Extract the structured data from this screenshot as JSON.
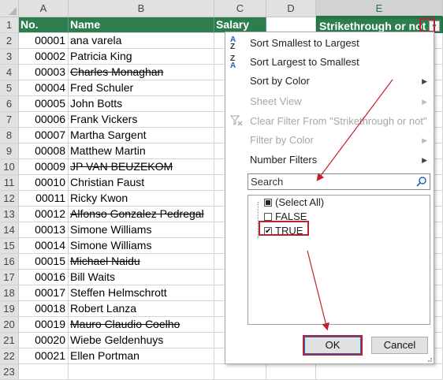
{
  "columns": [
    "A",
    "B",
    "C",
    "D",
    "E"
  ],
  "header_row": {
    "row_number": "1",
    "no": "No.",
    "name": "Name",
    "salary": "Salary",
    "flag": "Strikethrough or not"
  },
  "rows": [
    {
      "row": "2",
      "no": "00001",
      "name": "ana varela",
      "strike": false
    },
    {
      "row": "3",
      "no": "00002",
      "name": "Patricia King",
      "strike": false
    },
    {
      "row": "4",
      "no": "00003",
      "name": "Charles Monaghan",
      "strike": true
    },
    {
      "row": "5",
      "no": "00004",
      "name": "Fred Schuler",
      "strike": false
    },
    {
      "row": "6",
      "no": "00005",
      "name": "John Botts",
      "strike": false
    },
    {
      "row": "7",
      "no": "00006",
      "name": "Frank Vickers",
      "strike": false
    },
    {
      "row": "8",
      "no": "00007",
      "name": "Martha Sargent",
      "strike": false
    },
    {
      "row": "9",
      "no": "00008",
      "name": "Matthew Martin",
      "strike": false
    },
    {
      "row": "10",
      "no": "00009",
      "name": "JP VAN BEUZEKOM",
      "strike": true
    },
    {
      "row": "11",
      "no": "00010",
      "name": "Christian Faust",
      "strike": false
    },
    {
      "row": "12",
      "no": "00011",
      "name": "Ricky Kwon",
      "strike": false
    },
    {
      "row": "13",
      "no": "00012",
      "name": "Alfonso Gonzalez Pedregal",
      "strike": true
    },
    {
      "row": "14",
      "no": "00013",
      "name": "Simone Williams",
      "strike": false
    },
    {
      "row": "15",
      "no": "00014",
      "name": "Simone Williams",
      "strike": false
    },
    {
      "row": "16",
      "no": "00015",
      "name": "Michael Naidu",
      "strike": true
    },
    {
      "row": "17",
      "no": "00016",
      "name": "Bill Waits",
      "strike": false
    },
    {
      "row": "18",
      "no": "00017",
      "name": "Steffen Helmschrott",
      "strike": false
    },
    {
      "row": "19",
      "no": "00018",
      "name": "Robert Lanza",
      "strike": false
    },
    {
      "row": "20",
      "no": "00019",
      "name": "Mauro Claudio Coelho",
      "strike": true
    },
    {
      "row": "21",
      "no": "00020",
      "name": "Wiebe Geldenhuys",
      "strike": false
    },
    {
      "row": "22",
      "no": "00021",
      "name": "Ellen Portman",
      "strike": false
    },
    {
      "row": "23",
      "no": "",
      "name": "",
      "strike": false
    }
  ],
  "filter_menu": {
    "sort_asc": "Sort Smallest to Largest",
    "sort_desc": "Sort Largest to Smallest",
    "sort_by_color": "Sort by Color",
    "sheet_view": "Sheet View",
    "clear_filter": "Clear Filter From \"Strikethrough or not\"",
    "filter_by_color": "Filter by Color",
    "number_filters": "Number Filters",
    "search_placeholder": "Search",
    "items": [
      {
        "label": "(Select All)",
        "state": "mixed"
      },
      {
        "label": "FALSE",
        "state": "unchecked"
      },
      {
        "label": "TRUE",
        "state": "checked"
      }
    ],
    "ok_label": "OK",
    "cancel_label": "Cancel"
  },
  "colors": {
    "header_fill": "#2e7d4f",
    "excel_green": "#217346",
    "annotation_red": "#c0202e"
  }
}
